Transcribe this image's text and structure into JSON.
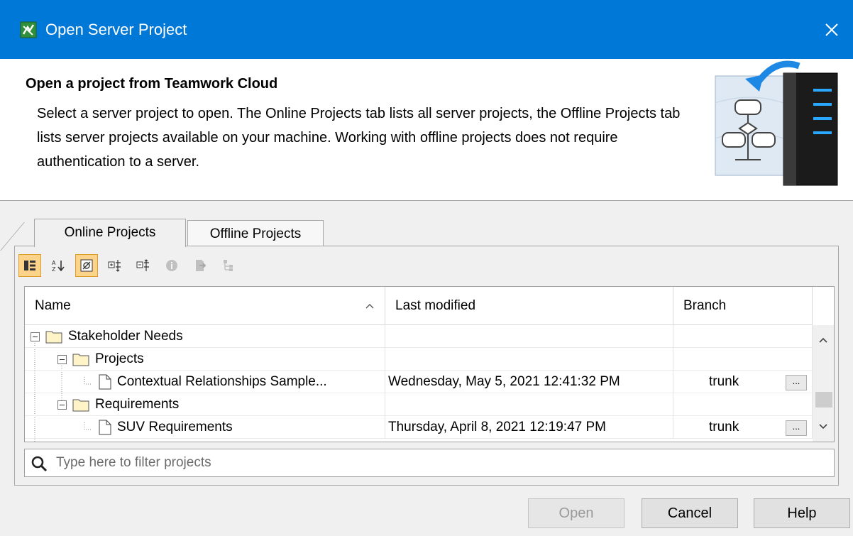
{
  "window": {
    "title": "Open Server Project"
  },
  "header": {
    "title": "Open a project from Teamwork Cloud",
    "description": "Select a server project to open. The Online Projects tab lists all server projects, the Offline Projects tab lists server projects available on your machine. Working with offline projects does not require authentication to a server."
  },
  "tabs": [
    {
      "label": "Online Projects",
      "selected": true
    },
    {
      "label": "Offline Projects",
      "selected": false
    }
  ],
  "table": {
    "columns": [
      "Name",
      "Last modified",
      "Branch"
    ],
    "rows": [
      {
        "type": "folder",
        "depth": 0,
        "name": "Stakeholder Needs",
        "modified": "",
        "branch": ""
      },
      {
        "type": "folder",
        "depth": 1,
        "name": "Projects",
        "modified": "",
        "branch": ""
      },
      {
        "type": "project",
        "depth": 2,
        "name": "Contextual Relationships Sample...",
        "modified": "Wednesday, May 5, 2021 12:41:32 PM",
        "branch": "trunk"
      },
      {
        "type": "folder",
        "depth": 1,
        "name": "Requirements",
        "modified": "",
        "branch": ""
      },
      {
        "type": "project",
        "depth": 2,
        "name": "SUV Requirements",
        "modified": "Thursday, April 8, 2021 12:19:47 PM",
        "branch": "trunk"
      }
    ],
    "more_label": "..."
  },
  "filter": {
    "placeholder": "Type here to filter projects",
    "value": ""
  },
  "buttons": {
    "open": "Open",
    "cancel": "Cancel",
    "help": "Help"
  }
}
